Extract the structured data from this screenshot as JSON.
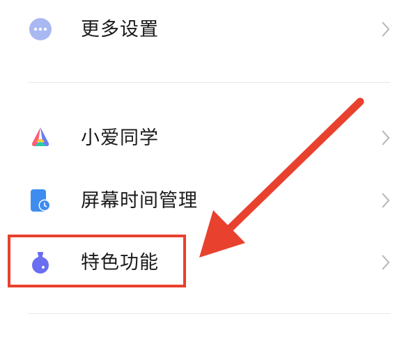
{
  "settings": {
    "items": [
      {
        "label": "更多设置",
        "icon": "more-dots-icon"
      },
      {
        "label": "小爱同学",
        "icon": "xiaoai-assistant-icon"
      },
      {
        "label": "屏幕时间管理",
        "icon": "screen-time-icon"
      },
      {
        "label": "特色功能",
        "icon": "flask-icon"
      }
    ]
  },
  "annotation": {
    "highlight_color": "#e8412e",
    "arrow_color": "#e8412e",
    "highlighted_item": "特色功能"
  },
  "colors": {
    "text": "#1a1a1a",
    "chevron": "#b5b5b5",
    "divider": "#e8e8e8",
    "more_icon": "#a9b8f0",
    "screen_time_icon": "#3f8cf0",
    "flask_icon": "#6a6ef0"
  }
}
